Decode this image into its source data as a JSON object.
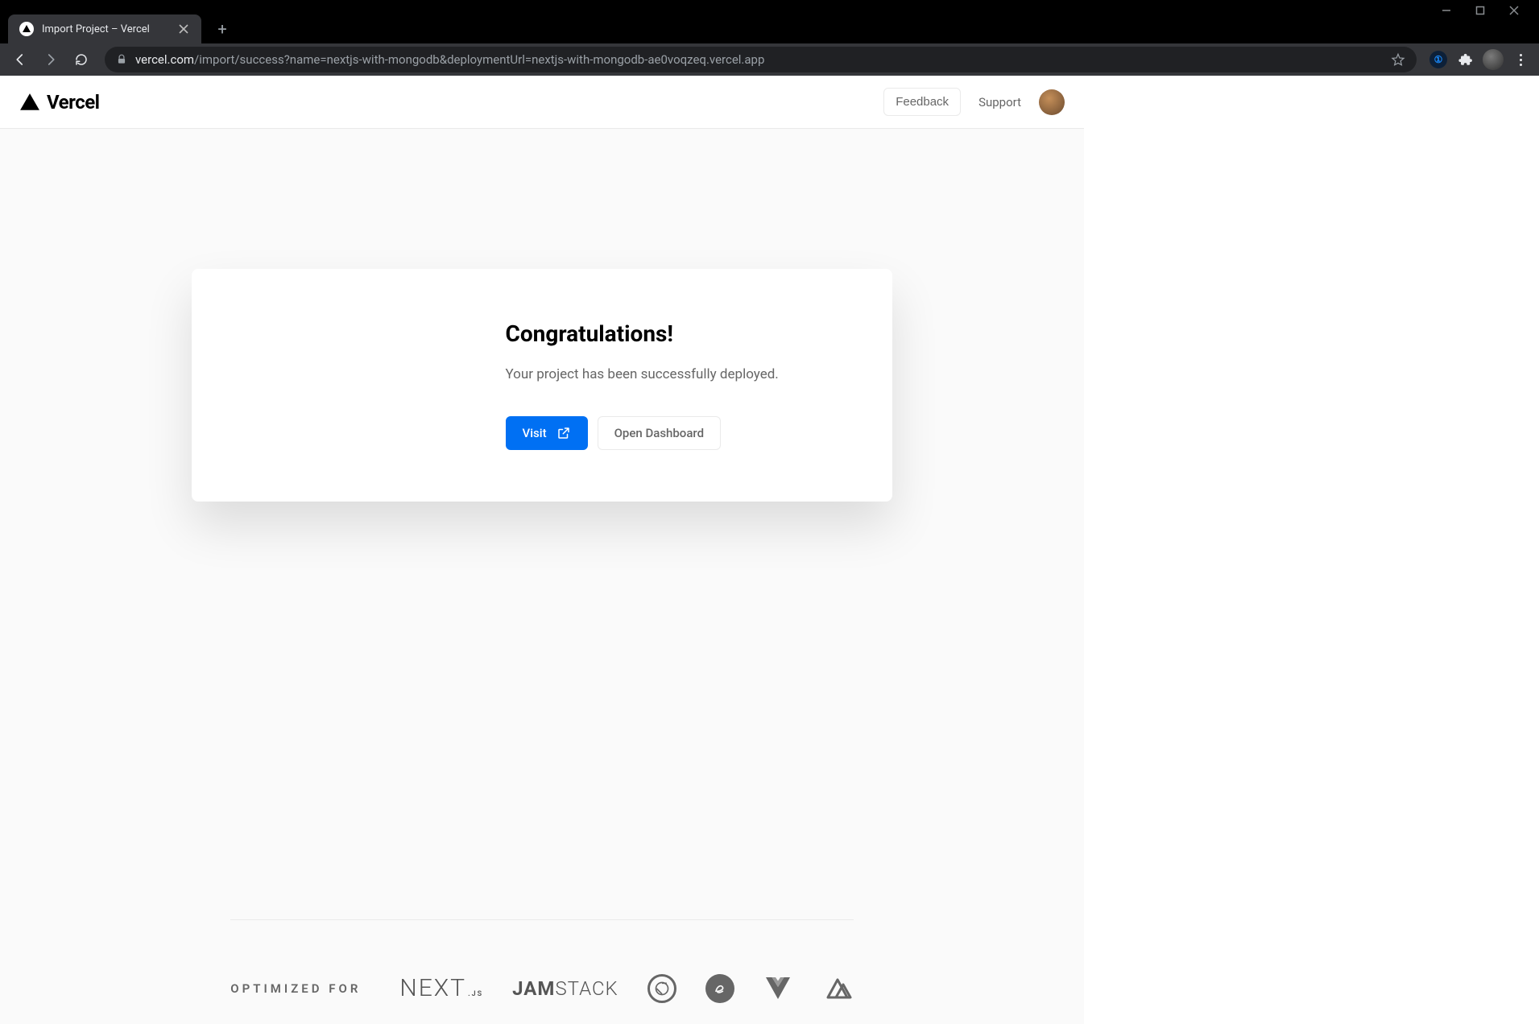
{
  "browser": {
    "tab_title": "Import Project – Vercel",
    "url_host": "vercel.com",
    "url_path": "/import/success?name=nextjs-with-mongodb&deploymentUrl=nextjs-with-mongodb-ae0voqzeq.vercel.app"
  },
  "header": {
    "brand": "Vercel",
    "feedback": "Feedback",
    "support": "Support"
  },
  "card": {
    "title": "Congratulations!",
    "subtitle": "Your project has been successfully deployed.",
    "visit": "Visit",
    "dashboard": "Open Dashboard"
  },
  "footer": {
    "label": "OPTIMIZED FOR",
    "next": "NEXT",
    "next_sub": ".JS",
    "jam": "JAM",
    "stack": "STACK"
  }
}
